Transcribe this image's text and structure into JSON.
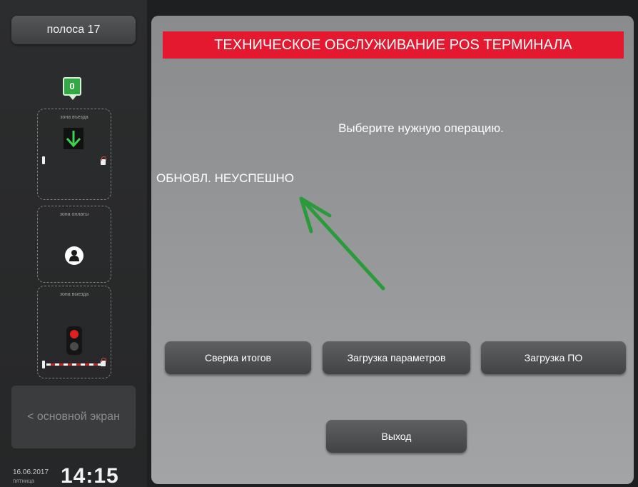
{
  "sidebar": {
    "lane_label": "полоса 17",
    "counter": "0",
    "zones": [
      {
        "label": "зона въезда"
      },
      {
        "label": "зона оплаты"
      },
      {
        "label": "зона выезда"
      }
    ],
    "back_label": "< основной экран",
    "date": "16.06.2017",
    "weekday": "пятница",
    "time": "14:15"
  },
  "main": {
    "title": "ТЕХНИЧЕСКОЕ ОБСЛУЖИВАНИЕ POS ТЕРМИНАЛА",
    "prompt": "Выберите нужную операцию.",
    "status": "ОБНОВЛ. НЕУСПЕШНО",
    "buttons": {
      "reconcile": "Сверка итогов",
      "params": "Загрузка параметров",
      "software": "Загрузка ПО",
      "exit": "Выход"
    }
  },
  "colors": {
    "title_bg": "#e4182e",
    "badge_green": "#33a845",
    "annotation_arrow": "#2a9a3a"
  },
  "icons": {
    "entry_zone": "arrow-down-icon",
    "payment_zone": "person-icon",
    "exit_zone": "traffic-light-icon",
    "annotation": "annotation-arrow"
  }
}
